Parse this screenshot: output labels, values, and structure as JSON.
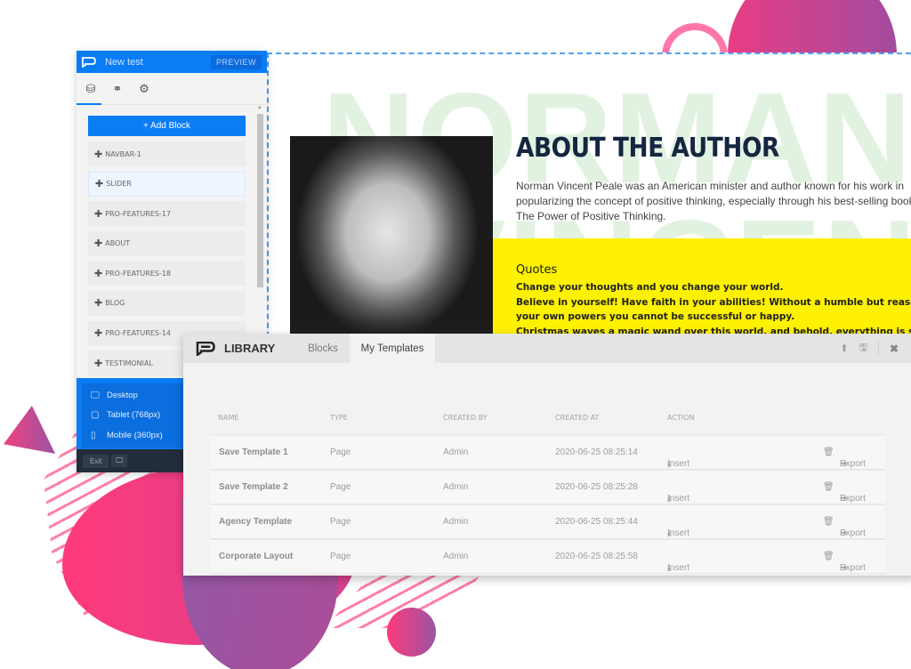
{
  "editor": {
    "title": "New test",
    "preview_label": "PREVIEW",
    "sidebar_tabs": [
      {
        "icon": "blocks-icon",
        "glyph": "⛁"
      },
      {
        "icon": "link-icon",
        "glyph": "⚭"
      },
      {
        "icon": "gear-icon",
        "glyph": "⚙"
      }
    ],
    "add_block_label": "+ Add Block",
    "blocks": [
      {
        "label": "NAVBAR-1",
        "active": false
      },
      {
        "label": "SLIDER",
        "active": true
      },
      {
        "label": "PRO-FEATURES-17",
        "active": false
      },
      {
        "label": "ABOUT",
        "active": false
      },
      {
        "label": "PRO-FEATURES-18",
        "active": false
      },
      {
        "label": "BLOG",
        "active": false
      },
      {
        "label": "PRO-FEATURES-14",
        "active": false
      },
      {
        "label": "TESTIMONIAL",
        "active": false
      }
    ],
    "devices": [
      {
        "label": "Desktop",
        "icon": "desktop-icon",
        "glyph": "🖵"
      },
      {
        "label": "Tablet (768px)",
        "icon": "tablet-icon",
        "glyph": "▢"
      },
      {
        "label": "Mobile (360px)",
        "icon": "mobile-icon",
        "glyph": "▯"
      }
    ],
    "exit_label": "Exit",
    "monitor_glyph": "🖵"
  },
  "canvas": {
    "bg_word_1": "NORMAN",
    "bg_word_2": "VINCENT",
    "about_title": "ABOUT THE AUTHOR",
    "about_text": "Norman Vincent Peale was an American minister and author known for his work in popularizing the concept of positive thinking, especially through his best-selling book The Power of Positive Thinking.",
    "quotes_title": "Quotes",
    "quotes": [
      "Change your thoughts and you change your world.",
      "Believe in yourself! Have faith in your abilities! Without a humble but reasonable confidence in",
      "your own powers you cannot be successful or happy.",
      "Christmas waves a magic wand over this world, and behold, everything is softer and more"
    ],
    "colors": {
      "accent_blue": "#0a7cf4",
      "quote_bg": "#fef101",
      "title": "#152641"
    }
  },
  "library": {
    "title": "LIBRARY",
    "tabs": [
      {
        "label": "Blocks",
        "active": false
      },
      {
        "label": "My Templates",
        "active": true
      }
    ],
    "actions": {
      "upload_glyph": "⬆",
      "save_glyph": "🖫",
      "close_glyph": "✖"
    },
    "columns": [
      "NAME",
      "TYPE",
      "CREATED BY",
      "CREATED AT",
      "ACTION"
    ],
    "rows": [
      {
        "name": "Save Template 1",
        "type": "Page",
        "created_by": "Admin",
        "created_at": "2020-06-25 08:25:14",
        "insert": "Insert",
        "export": "Export"
      },
      {
        "name": "Save Template 2",
        "type": "Page",
        "created_by": "Admin",
        "created_at": "2020-06-25 08:25:28",
        "insert": "Insert",
        "export": "Export"
      },
      {
        "name": "Agency Template",
        "type": "Page",
        "created_by": "Admin",
        "created_at": "2020-06-25 08:25:44",
        "insert": "Insert",
        "export": "Export"
      },
      {
        "name": "Corporate Layout",
        "type": "Page",
        "created_by": "Admin",
        "created_at": "2020-06-25 08:25:58",
        "insert": "Insert",
        "export": "Export"
      }
    ],
    "glyphs": {
      "insert": "⤓",
      "delete": "🗑",
      "export": "➜"
    }
  }
}
